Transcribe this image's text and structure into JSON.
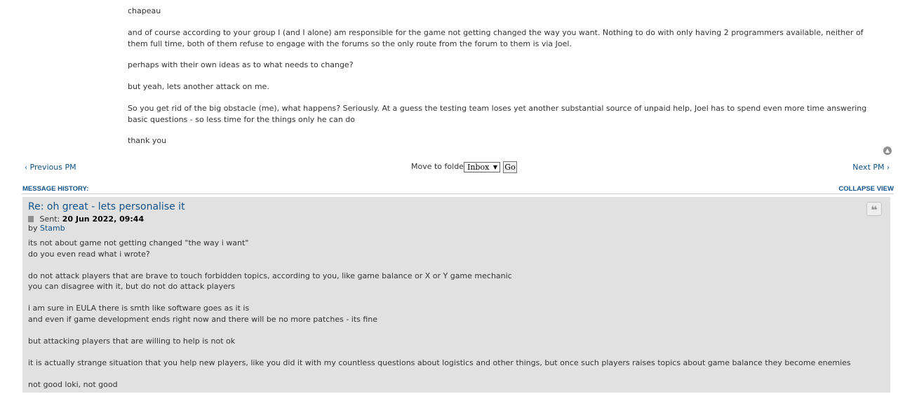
{
  "message": {
    "paragraphs": [
      "chapeau",
      "and of course according to your group I (and I alone) am responsible for the game not getting changed the way you want. Nothing to do with only having 2 programmers available, neither of them full time, both of them refuse to engage with the forums so the only route from the forum to them is via Joel.",
      "perhaps with their own ideas as to what needs to change?",
      "but yeah, lets another attack on me.",
      "So you get rid of the big obstacle (me), what happens? Seriously. At a guess the testing team loses yet another substantial source of unpaid help, Joel has to spend even more time answering basic questions - so less time for the things only he can do",
      "thank you"
    ]
  },
  "navigation": {
    "previous_label": "Previous PM",
    "next_label": "Next PM",
    "move_to_folder_label": "Move to folder:",
    "folder_selected": "Inbox",
    "go_label": "Go"
  },
  "history": {
    "title": "MESSAGE HISTORY:",
    "collapse_label": "COLLAPSE VIEW",
    "post": {
      "title": "Re: oh great - lets personalise it",
      "sent_label": "Sent:",
      "sent_date": "20 Jun 2022, 09:44",
      "by_label": "by",
      "author": "Stamb",
      "lines": [
        "its not about game not getting changed \"the way i want\"",
        "do you even read what i wrote?",
        "",
        "do not attack players that are brave to touch forbidden topics, according to you, like game balance or X or Y game mechanic",
        "you can disagree with it, but do not do attack players",
        "",
        "i am sure in EULA there is smth like software goes as it is",
        "and even if game development ends right now and there will be no more patches - its fine",
        "",
        "but attacking players that are willing to help is not ok",
        "",
        "it is actually strange situation that you help new players, like you did it with my countless questions about logistics and other things, but once such players raises topics about game balance they become enemies",
        "",
        "not good loki, not good"
      ]
    }
  },
  "icons": {
    "back_to_top": "arrow-up-circle-icon",
    "quote": "quote-icon",
    "post": "document-icon",
    "prev": "chevron-left-icon",
    "next": "chevron-right-icon"
  },
  "colors": {
    "link": "#105289",
    "post_bg": "#e1e1e1"
  }
}
